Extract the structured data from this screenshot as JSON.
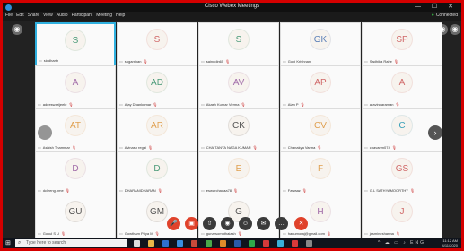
{
  "window": {
    "title": "Cisco Webex Meetings",
    "controls": "— ☐ ✕"
  },
  "menu": [
    "File",
    "Edit",
    "Share",
    "View",
    "Audio",
    "Participant",
    "Meeting",
    "Help"
  ],
  "connection": "Connected",
  "participants": [
    {
      "initials": "S",
      "name": "siddharth",
      "color": "#4a9a78",
      "active": true,
      "muted": false
    },
    {
      "initials": "S",
      "name": "suganthan",
      "color": "#d06868",
      "active": false,
      "muted": true
    },
    {
      "initials": "S",
      "name": "sainudin65",
      "color": "#4a9a78",
      "active": false,
      "muted": true
    },
    {
      "initials": "GK",
      "name": "Gopi Krishnan",
      "color": "#5a7fb8",
      "active": false,
      "muted": false
    },
    {
      "initials": "SP",
      "name": "Sadhika Rahe",
      "color": "#d06868",
      "active": false,
      "muted": true
    },
    {
      "initials": "A",
      "name": "adeeswarijeele",
      "color": "#a06aa8",
      "active": false,
      "muted": true
    },
    {
      "initials": "AD",
      "name": "Ajay Dhankumar",
      "color": "#4a9a78",
      "active": false,
      "muted": true
    },
    {
      "initials": "AV",
      "name": "Akash Kumar Verma",
      "color": "#a06aa8",
      "active": false,
      "muted": true
    },
    {
      "initials": "AP",
      "name": "Alan P",
      "color": "#d06868",
      "active": false,
      "muted": true
    },
    {
      "initials": "A",
      "name": "aravindaraman",
      "color": "#d06868",
      "active": false,
      "muted": true
    },
    {
      "initials": "AT",
      "name": "Ashish Thammar",
      "color": "#e0a050",
      "active": false,
      "muted": true
    },
    {
      "initials": "AR",
      "name": "Avinash regai",
      "color": "#e0a050",
      "active": false,
      "muted": true
    },
    {
      "initials": "CK",
      "name": "CHAITANYA NAGA KUMAR",
      "color": "#555555",
      "active": false,
      "muted": true
    },
    {
      "initials": "CV",
      "name": "Chanakya Varma",
      "color": "#e0a050",
      "active": false,
      "muted": true
    },
    {
      "initials": "C",
      "name": "chavanm074",
      "color": "#3aa0b8",
      "active": false,
      "muted": true
    },
    {
      "initials": "D",
      "name": "dcleeng.bme",
      "color": "#a06aa8",
      "active": false,
      "muted": true
    },
    {
      "initials": "D",
      "name": "DHARANIDHARAN",
      "color": "#4a9a78",
      "active": false,
      "muted": true
    },
    {
      "initials": "E",
      "name": "eswarchadaa78",
      "color": "#e0a050",
      "active": false,
      "muted": true
    },
    {
      "initials": "F",
      "name": "Fawaaz",
      "color": "#e0a050",
      "active": false,
      "muted": true
    },
    {
      "initials": "GS",
      "name": "G.L SATHYAMOORTHY",
      "color": "#d06868",
      "active": false,
      "muted": true
    },
    {
      "initials": "GU",
      "name": "Gokul S U",
      "color": "#555555",
      "active": false,
      "muted": true
    },
    {
      "initials": "GM",
      "name": "Gowtham Priya M",
      "color": "#555555",
      "active": false,
      "muted": true
    },
    {
      "initials": "G",
      "name": "gunarsomuthaiash",
      "color": "#555555",
      "active": false,
      "muted": true
    },
    {
      "initials": "H",
      "name": "hanumoraj@gmail.com",
      "color": "#a06aa8",
      "active": false,
      "muted": true
    },
    {
      "initials": "J",
      "name": "jasminesharma",
      "color": "#d06868",
      "active": false,
      "muted": true
    }
  ],
  "taskbar": {
    "search_placeholder": "Type here to search",
    "tray_lang": "ENG",
    "tray_region": "US",
    "time": "11:12 AM",
    "date": "4/11/2020"
  }
}
